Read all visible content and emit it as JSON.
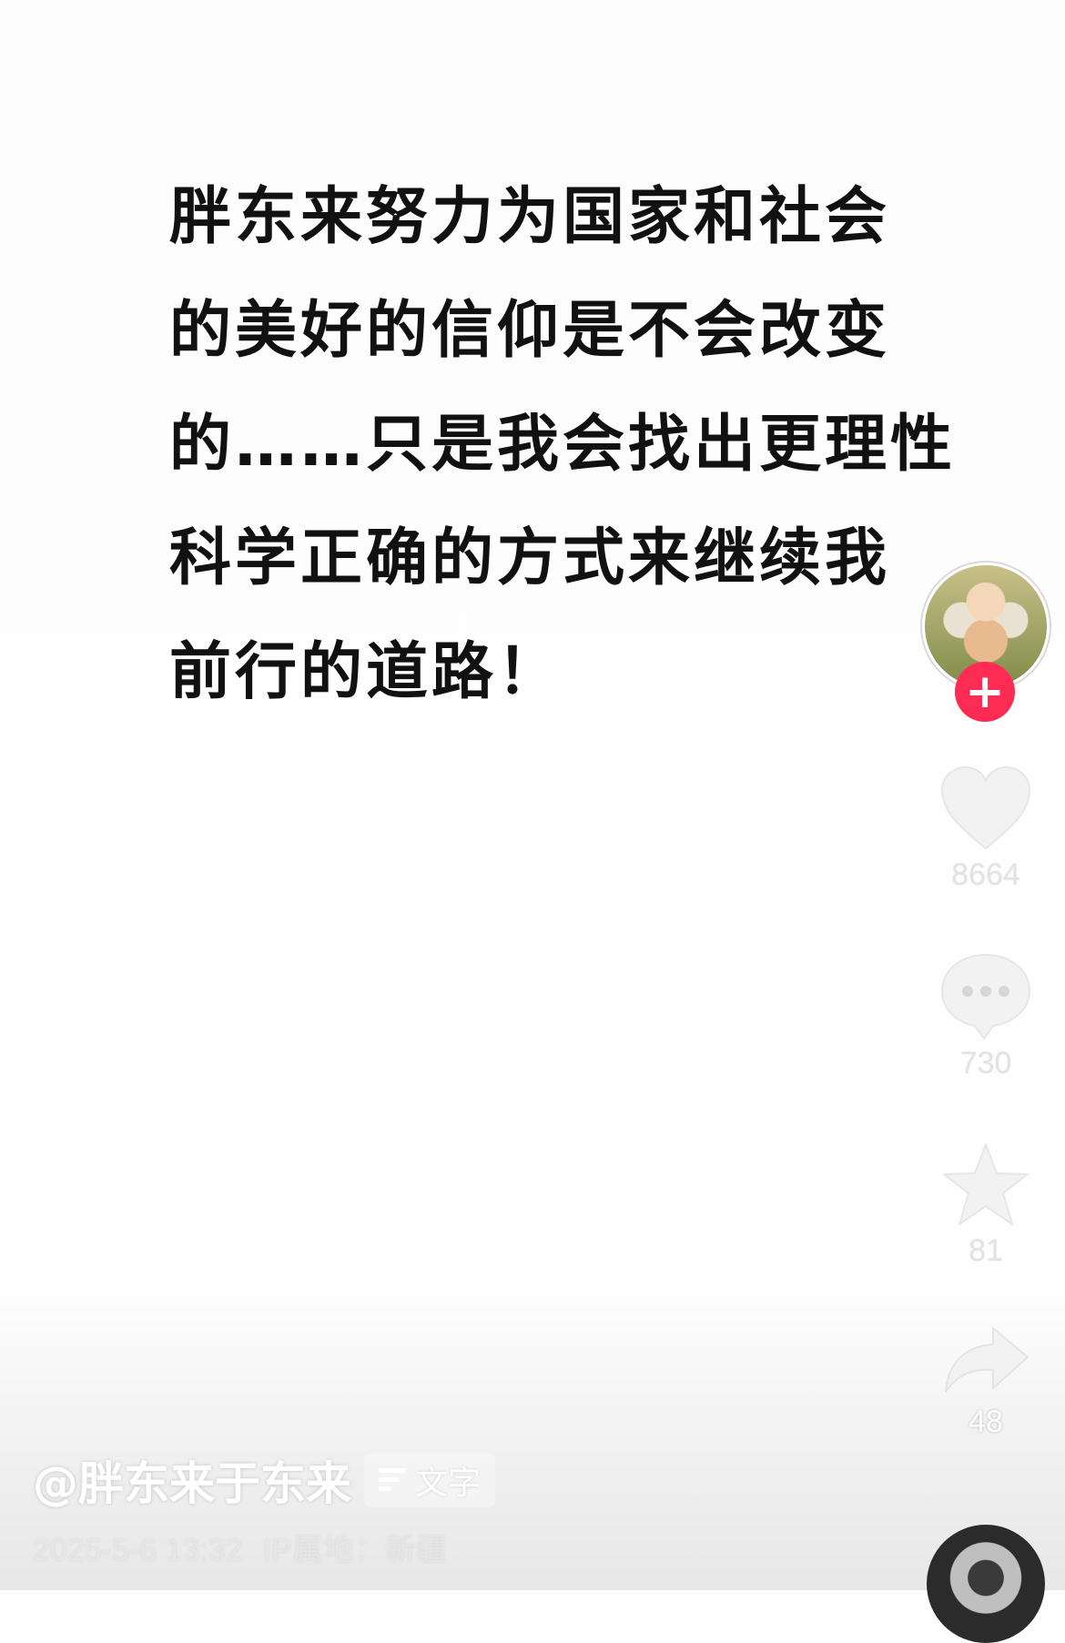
{
  "post": {
    "lines": [
      "胖东来努力为国家和社会",
      "的美好的信仰是不会改变",
      "的……只是我会找出更理性",
      "科学正确的方式来继续我",
      "前行的道路！"
    ]
  },
  "rail": {
    "follow_symbol": "+",
    "like_count": "8664",
    "comment_count": "730",
    "favorite_count": "81",
    "share_count": "48"
  },
  "author": {
    "name": "@胖东来于东来",
    "tag_label": "文字"
  },
  "meta": {
    "datetime": "2025-5-6 13:32",
    "ip_location": "IP属地：新疆"
  },
  "colors": {
    "accent": "#fe2c55",
    "text_primary": "#111111",
    "icon_fill": "#f2f2f2"
  },
  "icons": {
    "like": "heart-icon",
    "comment": "comment-bubble-icon",
    "favorite": "star-icon",
    "share": "share-arrow-icon",
    "tag": "text-lines-icon"
  }
}
